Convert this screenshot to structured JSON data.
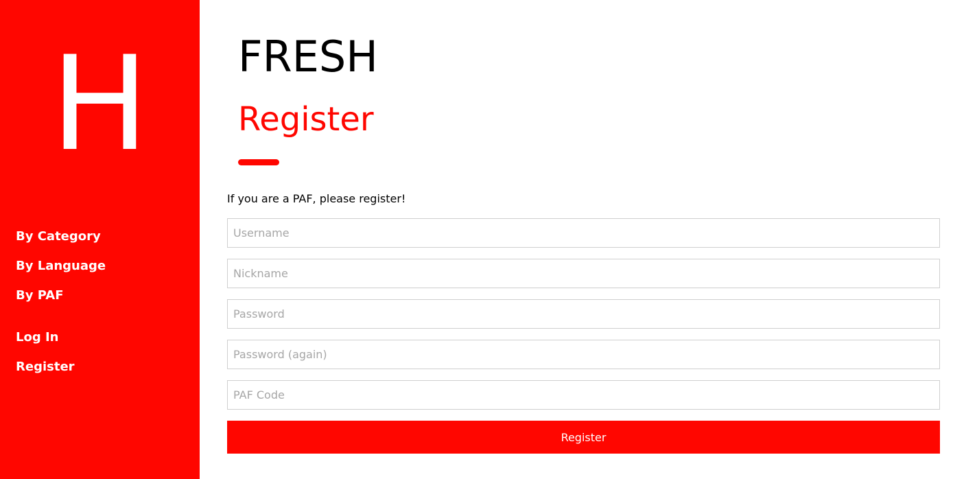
{
  "colors": {
    "accent": "#ff0600",
    "sidebar_text": "#ffffff",
    "input_border": "#cfcfcf",
    "placeholder": "#a6a6a6"
  },
  "sidebar": {
    "logo_letter": "H",
    "nav_items": [
      {
        "label": "By Category"
      },
      {
        "label": "By Language"
      },
      {
        "label": "By PAF"
      }
    ],
    "account_items": [
      {
        "label": "Log In"
      },
      {
        "label": "Register"
      }
    ]
  },
  "main": {
    "brand": "FRESH",
    "page_title": "Register",
    "intro": "If you are a PAF, please register!",
    "form": {
      "username_placeholder": "Username",
      "nickname_placeholder": "Nickname",
      "password_placeholder": "Password",
      "password_again_placeholder": "Password (again)",
      "paf_code_placeholder": "PAF Code",
      "submit_label": "Register"
    }
  }
}
